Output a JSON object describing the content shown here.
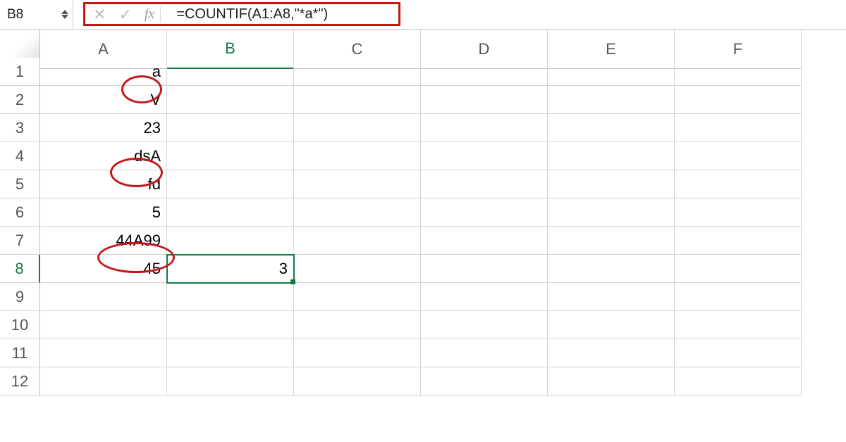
{
  "namebox": {
    "value": "B8"
  },
  "formula": "=COUNTIF(A1:A8,\"*a*\")",
  "fx_label": "fx",
  "cancel_glyph": "✕",
  "accept_glyph": "✓",
  "columns": [
    "A",
    "B",
    "C",
    "D",
    "E",
    "F"
  ],
  "active_col": "B",
  "active_row": 8,
  "rows": [
    1,
    2,
    3,
    4,
    5,
    6,
    7,
    8,
    9,
    10,
    11,
    12
  ],
  "cells": {
    "A1": "a",
    "A2": "V",
    "A3": "23",
    "A4": "dsA",
    "A5": "fd",
    "A6": "5",
    "A7": "44A99",
    "A8": "45",
    "B8": "3"
  },
  "circled_cells": [
    "A1",
    "A4",
    "A7"
  ]
}
